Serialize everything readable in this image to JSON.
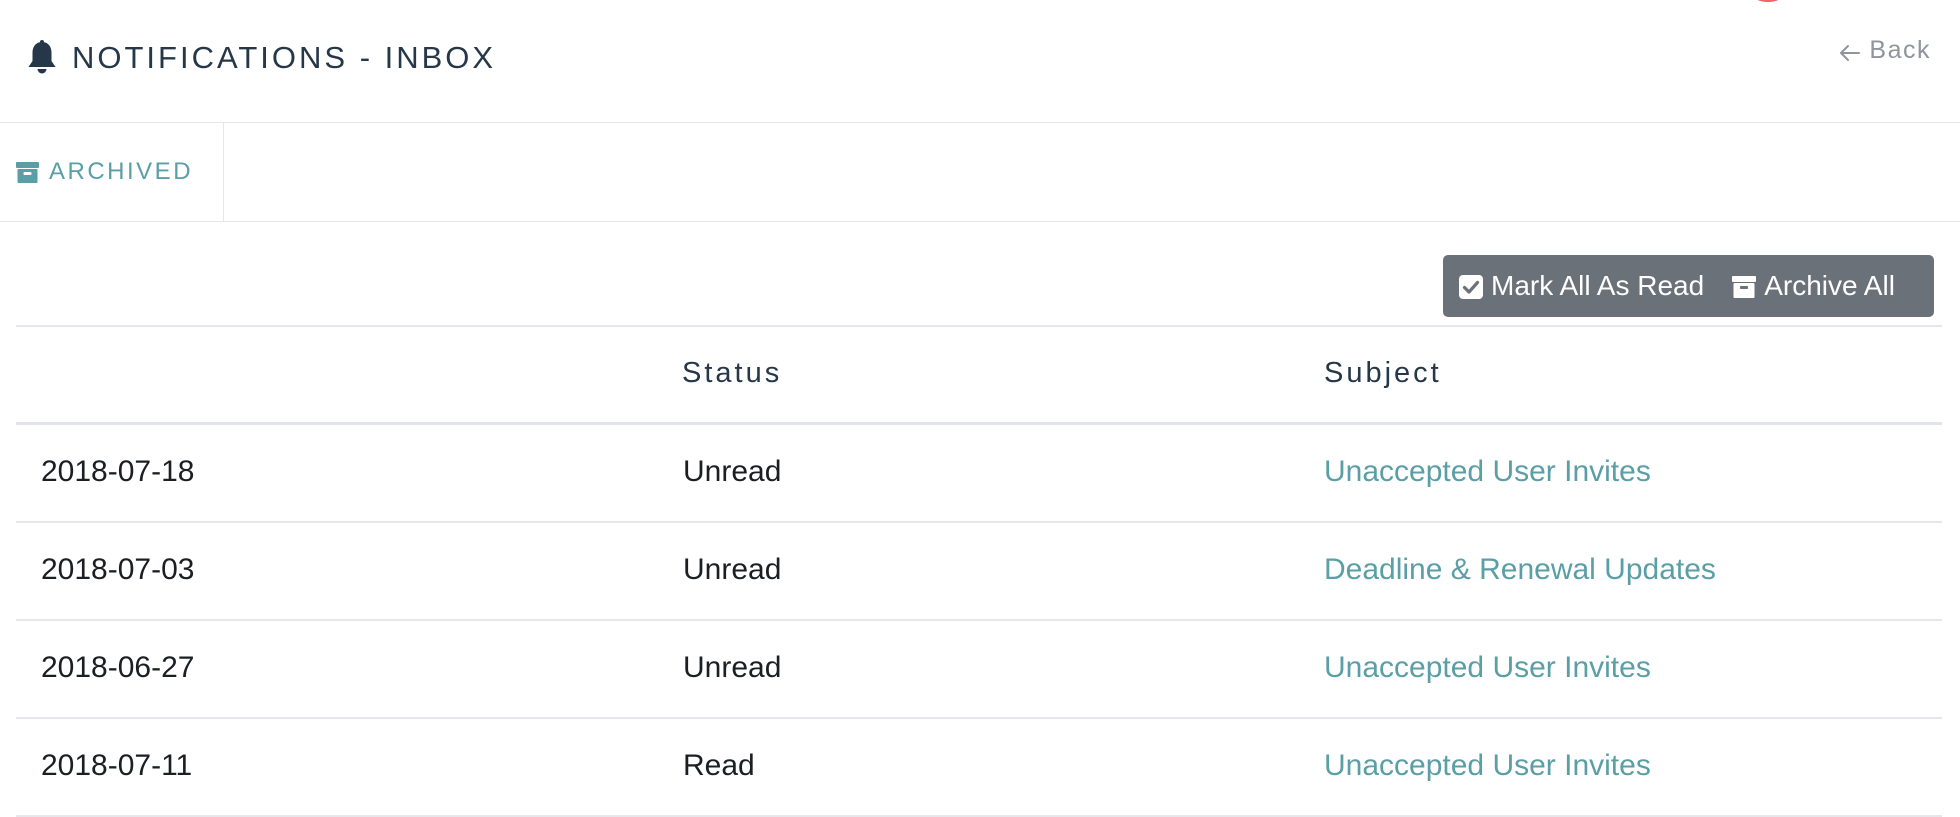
{
  "header": {
    "title": "NOTIFICATIONS - INBOX",
    "back_label": "Back"
  },
  "tabs": [
    {
      "label": "ARCHIVED"
    }
  ],
  "actions": {
    "mark_all_read": "Mark All As Read",
    "archive_all": "Archive All"
  },
  "table": {
    "headers": {
      "date": "",
      "status": "Status",
      "subject": "Subject"
    },
    "rows": [
      {
        "date": "2018-07-18",
        "status": "Unread",
        "subject": "Unaccepted User Invites"
      },
      {
        "date": "2018-07-03",
        "status": "Unread",
        "subject": "Deadline & Renewal Updates"
      },
      {
        "date": "2018-06-27",
        "status": "Unread",
        "subject": "Unaccepted User Invites"
      },
      {
        "date": "2018-07-11",
        "status": "Read",
        "subject": "Unaccepted User Invites"
      }
    ]
  },
  "colors": {
    "accent": "#5a9ea6",
    "title": "#253748",
    "button_bg": "#6b7178",
    "badge": "#f4646d"
  },
  "icons": {
    "title": "bell-icon",
    "back": "arrow-left-icon",
    "tab": "archive-box-icon",
    "mark_all_read": "checkbox-checked-icon",
    "archive_all": "archive-box-icon"
  }
}
